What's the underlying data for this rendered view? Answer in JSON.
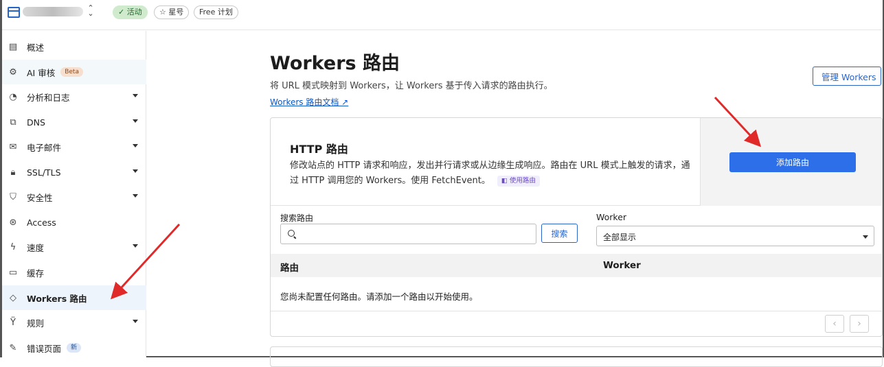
{
  "topbar": {
    "status_label": "✓ 活动",
    "star_label": "☆ 星号",
    "plan_label": "Free 计划"
  },
  "sidebar": {
    "items": [
      {
        "label": "概述",
        "icon": "clipboard-icon",
        "glyph": "▤",
        "caret": false
      },
      {
        "label": "AI 审核",
        "icon": "robot-icon",
        "glyph": "⚙",
        "caret": false,
        "badge": "Beta"
      },
      {
        "label": "分析和日志",
        "icon": "pie-chart-icon",
        "glyph": "◔",
        "caret": true
      },
      {
        "label": "DNS",
        "icon": "network-icon",
        "glyph": "⧉",
        "caret": true
      },
      {
        "label": "电子邮件",
        "icon": "email-icon",
        "glyph": "✉",
        "caret": true
      },
      {
        "label": "SSL/TLS",
        "icon": "lock-icon",
        "glyph": "🔒︎",
        "caret": true
      },
      {
        "label": "安全性",
        "icon": "shield-icon",
        "glyph": "⛉",
        "caret": true
      },
      {
        "label": "Access",
        "icon": "access-icon",
        "glyph": "⊛",
        "caret": false
      },
      {
        "label": "速度",
        "icon": "lightning-icon",
        "glyph": "ϟ",
        "caret": true
      },
      {
        "label": "缓存",
        "icon": "storage-icon",
        "glyph": "▭",
        "caret": false
      },
      {
        "label": "Workers 路由",
        "icon": "workers-icon",
        "glyph": "◇",
        "caret": false,
        "selected": true
      },
      {
        "label": "规则",
        "icon": "rules-icon",
        "glyph": "Ÿ",
        "caret": true
      },
      {
        "label": "错误页面",
        "icon": "wrench-icon",
        "glyph": "✎",
        "caret": false,
        "badge": "新"
      }
    ]
  },
  "main": {
    "title": "Workers 路由",
    "subtitle": "将 URL 模式映射到 Workers，让 Workers 基于传入请求的路由执行。",
    "doc_link": "Workers 路由文档 ↗",
    "manage_button": "管理 Workers"
  },
  "card": {
    "title": "HTTP 路由",
    "description": "修改站点的 HTTP 请求和响应，发出并行请求或从边缘生成响应。路由在 URL 模式上触发的请求，通过 HTTP 调用您的 Workers。使用 FetchEvent。",
    "use_chip": "◧ 使用路由",
    "add_button": "添加路由",
    "search_label": "搜索路由",
    "search_value": "",
    "search_button": "搜索",
    "worker_label": "Worker",
    "worker_selected": "全部显示",
    "table": {
      "columns": [
        "路由",
        "Worker"
      ],
      "empty_text": "您尚未配置任何路由。请添加一个路由以开始使用。"
    },
    "pager_prev": "‹",
    "pager_next": "›"
  },
  "colors": {
    "accent": "#2c6fe8",
    "annotation_arrow": "#e02a2a",
    "status_green": "#cfeacd"
  }
}
